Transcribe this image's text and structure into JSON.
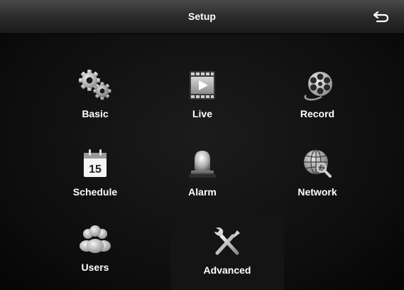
{
  "header": {
    "title": "Setup",
    "back_icon": "back-arrow-icon"
  },
  "menu": {
    "items": [
      {
        "label": "Basic",
        "icon": "gears-icon"
      },
      {
        "label": "Live",
        "icon": "video-play-icon"
      },
      {
        "label": "Record",
        "icon": "film-reel-icon"
      },
      {
        "label": "Schedule",
        "icon": "calendar-icon"
      },
      {
        "label": "Alarm",
        "icon": "siren-icon"
      },
      {
        "label": "Network",
        "icon": "globe-search-icon"
      },
      {
        "label": "Users",
        "icon": "users-group-icon"
      },
      {
        "label": "Advanced",
        "icon": "tools-icon"
      }
    ],
    "calendar_day": "15"
  }
}
